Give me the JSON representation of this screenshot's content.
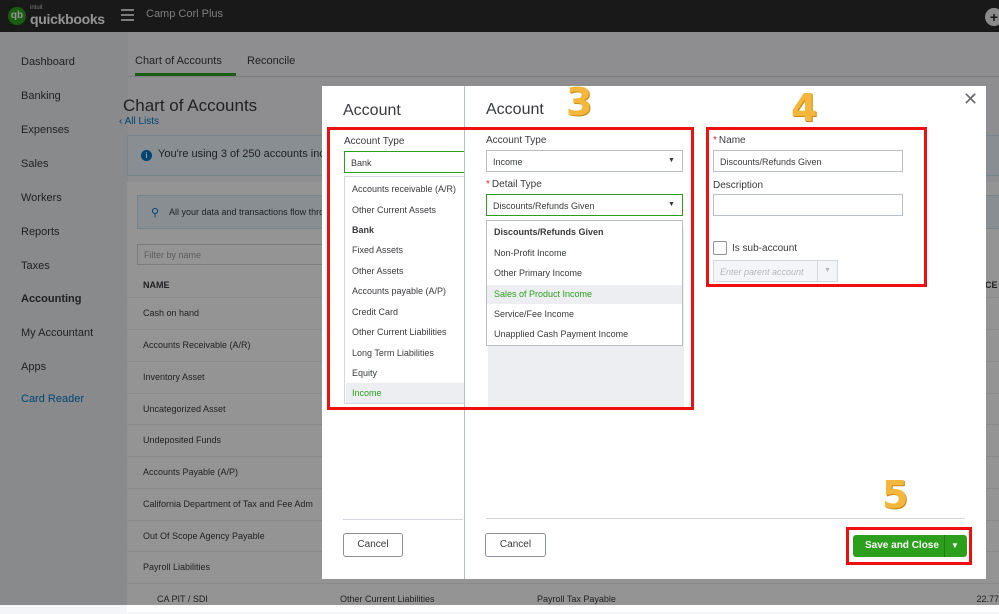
{
  "topbar": {
    "logo_small": "intuit",
    "logo_name": "quickbooks",
    "company": "Camp Corl Plus",
    "plus": "+"
  },
  "nav": {
    "items": [
      "Dashboard",
      "Banking",
      "Expenses",
      "Sales",
      "Workers",
      "Reports",
      "Taxes",
      "Accounting",
      "My Accountant",
      "Apps",
      "Card Reader"
    ],
    "active": "Accounting"
  },
  "tabs": [
    "Chart of Accounts",
    "Reconcile"
  ],
  "page": {
    "title": "Chart of Accounts",
    "all_lists": "All Lists",
    "info_text": "You're using 3 of 250 accounts inclu",
    "banner_text": "All your data and transactions flow thro",
    "filter_placeholder": "Filter by name",
    "col_name": "NAME",
    "col_ce": "CE",
    "rows": [
      "Cash on hand",
      "Accounts Receivable (A/R)",
      "Inventory Asset",
      "Uncategorized Asset",
      "Undeposited Funds",
      "Accounts Payable (A/P)",
      "California Department of Tax and Fee Adm",
      "Out Of Scope Agency Payable",
      "Payroll Liabilities"
    ],
    "last_row": {
      "name": "CA PIT / SDI",
      "type": "Other Current Liabilities",
      "detail": "Payroll Tax Payable",
      "balance": "22.77"
    }
  },
  "modal_left": {
    "title": "Account",
    "account_type_label": "Account Type",
    "account_type_value": "Bank",
    "options": [
      "Accounts receivable (A/R)",
      "Other Current Assets",
      "Bank",
      "Fixed Assets",
      "Other Assets",
      "Accounts payable (A/P)",
      "Credit Card",
      "Other Current Liabilities",
      "Long Term Liabilities",
      "Equity",
      "Income"
    ],
    "cancel": "Cancel"
  },
  "modal_right": {
    "title": "Account",
    "account_type_label": "Account Type",
    "account_type_value": "Income",
    "detail_type_label": "Detail Type",
    "detail_type_value": "Discounts/Refunds Given",
    "detail_options": [
      "Discounts/Refunds Given",
      "Non-Profit Income",
      "Other Primary Income",
      "Sales of Product Income",
      "Service/Fee Income",
      "Unapplied Cash Payment Income"
    ],
    "name_label": "Name",
    "name_value": "Discounts/Refunds Given",
    "description_label": "Description",
    "description_value": "",
    "sub_account_label": "Is sub-account",
    "parent_placeholder": "Enter parent account",
    "cancel": "Cancel",
    "save": "Save and Close",
    "close": "✕"
  },
  "annotations": {
    "step3": "3",
    "step4": "4",
    "step5": "5"
  },
  "colors": {
    "brand_green": "#2ca01c",
    "annotation_red": "#ee1010",
    "annotation_orange": "#f5b73b",
    "link_blue": "#0077c5"
  }
}
